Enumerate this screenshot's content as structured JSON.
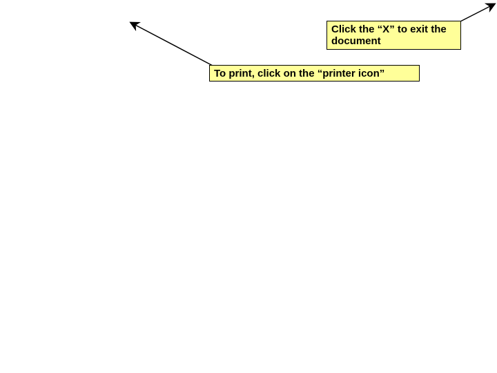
{
  "callouts": {
    "exit_doc": "Click the “X” to exit the document",
    "print_icon": "To print, click on the “printer icon”"
  },
  "colors": {
    "callout_bg": "#ffff99",
    "callout_border": "#000000",
    "arrow": "#000000"
  }
}
